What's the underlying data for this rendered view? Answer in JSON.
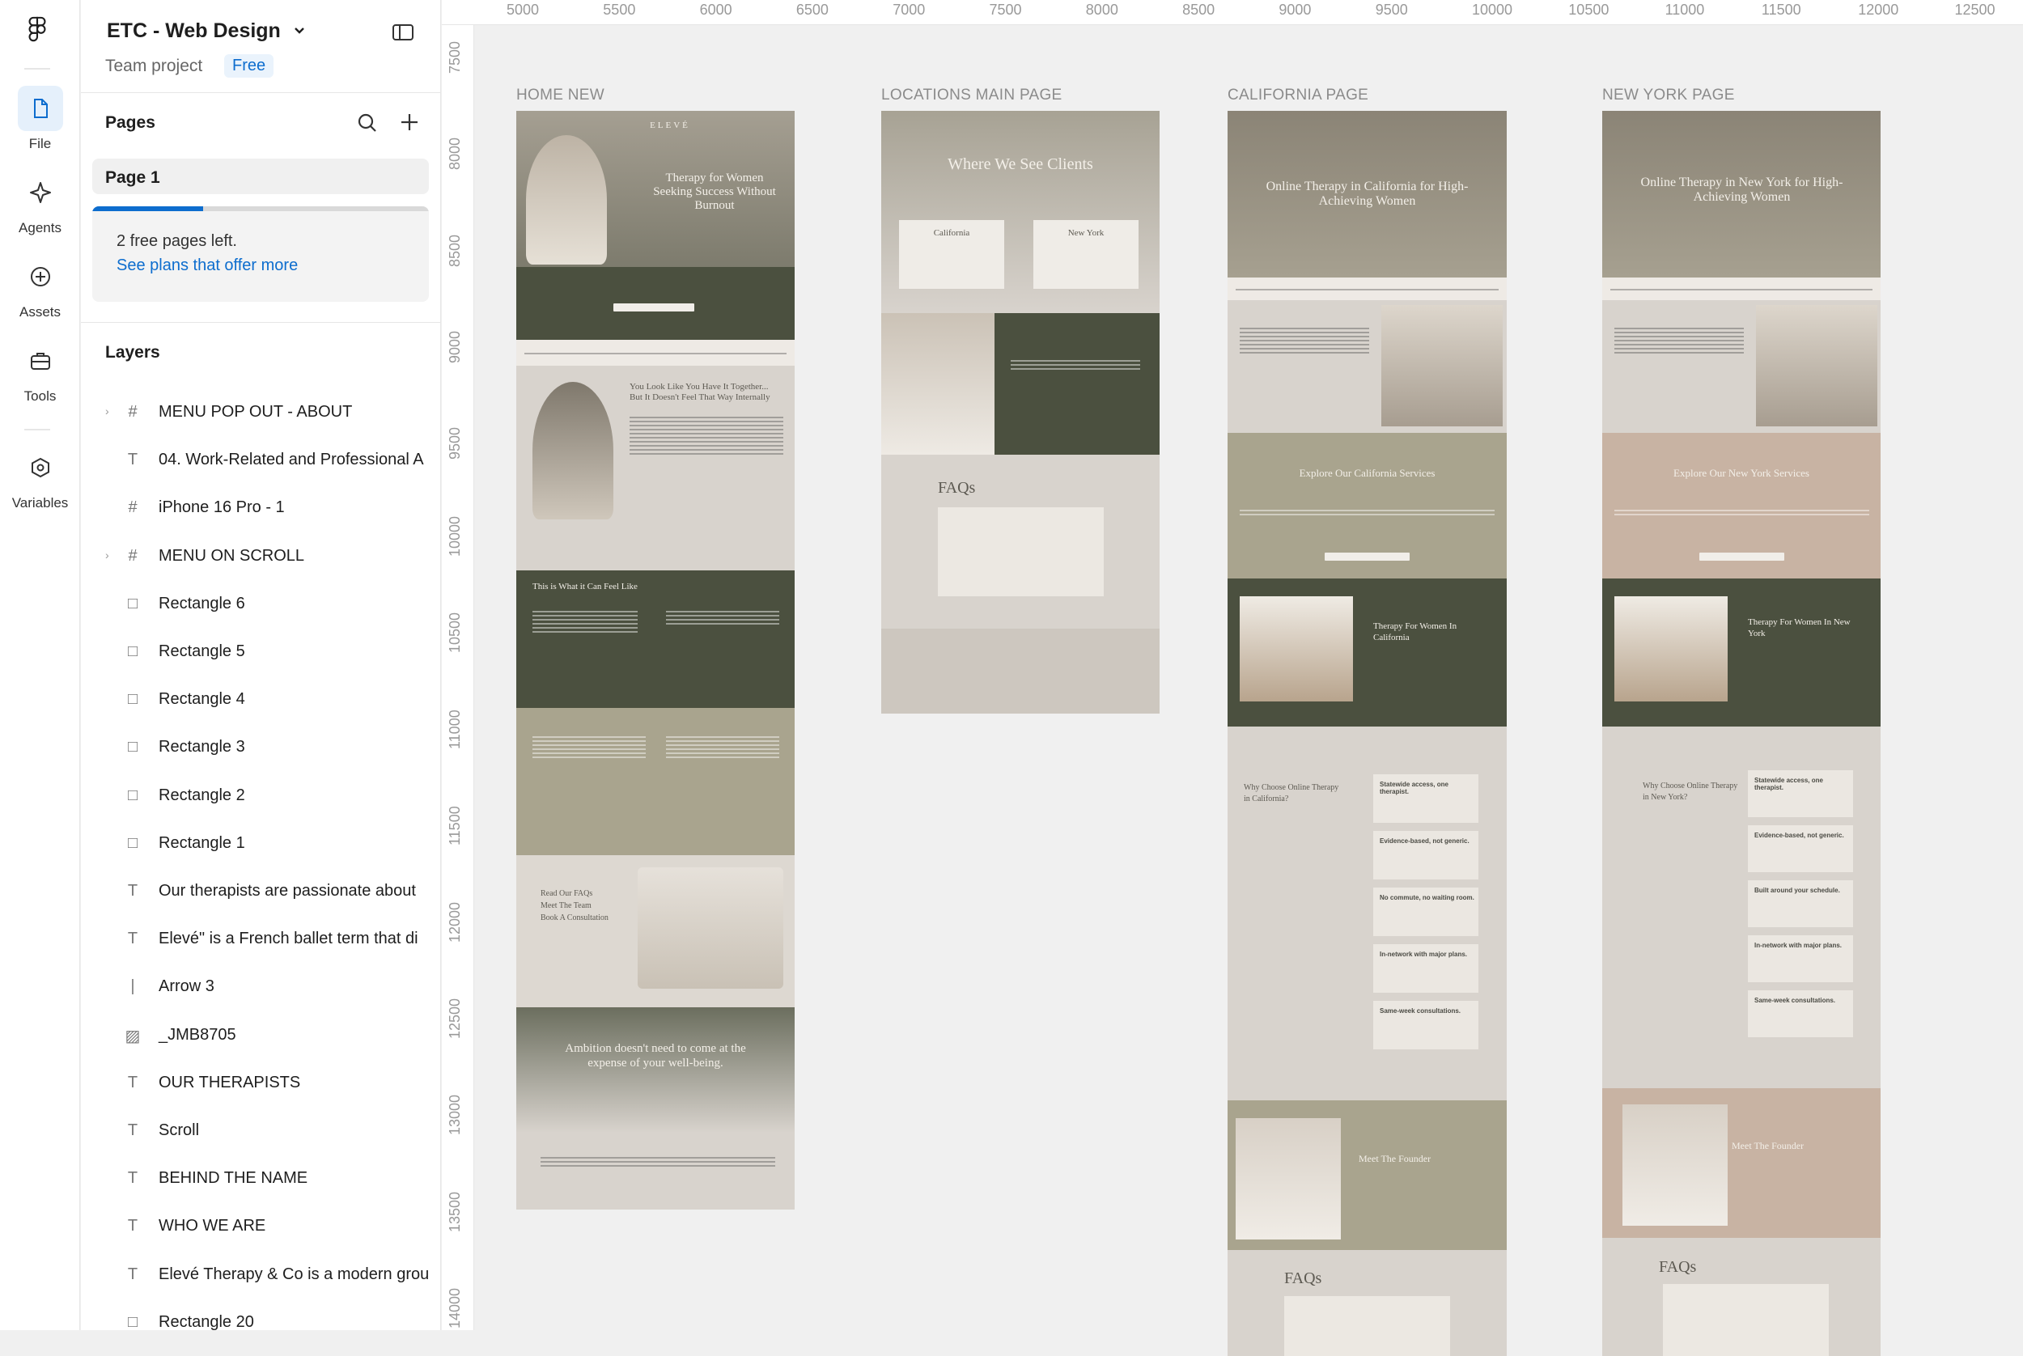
{
  "app": {
    "file_title": "ETC - Web Design",
    "team": "Team project",
    "plan_badge": "Free"
  },
  "rail": {
    "items": [
      {
        "label": "File",
        "icon": "file-icon"
      },
      {
        "label": "Agents",
        "icon": "agents-icon"
      },
      {
        "label": "Assets",
        "icon": "assets-icon"
      },
      {
        "label": "Tools",
        "icon": "tools-icon"
      },
      {
        "label": "Variables",
        "icon": "variables-icon"
      }
    ]
  },
  "pages": {
    "heading": "Pages",
    "items": [
      "Page 1"
    ],
    "free_pages_text": "2 free pages left.",
    "plans_link": "See plans that offer more",
    "usage_fraction": 0.33
  },
  "layers": {
    "heading": "Layers",
    "items": [
      {
        "label": "MENU POP OUT - ABOUT",
        "type": "frame",
        "expandable": true
      },
      {
        "label": "04. Work-Related and Professional A",
        "type": "text",
        "expandable": false
      },
      {
        "label": "iPhone 16 Pro - 1",
        "type": "frame",
        "expandable": false
      },
      {
        "label": "MENU ON SCROLL",
        "type": "frame",
        "expandable": true
      },
      {
        "label": "Rectangle 6",
        "type": "rect",
        "expandable": false
      },
      {
        "label": "Rectangle 5",
        "type": "rect",
        "expandable": false
      },
      {
        "label": "Rectangle 4",
        "type": "rect",
        "expandable": false
      },
      {
        "label": "Rectangle 3",
        "type": "rect",
        "expandable": false
      },
      {
        "label": "Rectangle 2",
        "type": "rect",
        "expandable": false
      },
      {
        "label": "Rectangle 1",
        "type": "rect",
        "expandable": false
      },
      {
        "label": "Our therapists are passionate about",
        "type": "text",
        "expandable": false
      },
      {
        "label": "Elevé\" is a French ballet term that di",
        "type": "text",
        "expandable": false
      },
      {
        "label": "Arrow 3",
        "type": "line",
        "expandable": false
      },
      {
        "label": "_JMB8705",
        "type": "image",
        "expandable": false
      },
      {
        "label": "OUR THERAPISTS",
        "type": "text",
        "expandable": false
      },
      {
        "label": "Scroll",
        "type": "text",
        "expandable": false
      },
      {
        "label": "BEHIND THE NAME",
        "type": "text",
        "expandable": false
      },
      {
        "label": "WHO WE ARE",
        "type": "text",
        "expandable": false
      },
      {
        "label": "Elevé Therapy & Co is a modern grou",
        "type": "text",
        "expandable": false
      },
      {
        "label": "Rectangle 20",
        "type": "rect",
        "expandable": false
      }
    ]
  },
  "ruler": {
    "x_ticks": [
      "5000",
      "5500",
      "6000",
      "6500",
      "7000",
      "7500",
      "8000",
      "8500",
      "9000",
      "9500",
      "10000",
      "10500",
      "11000",
      "11500",
      "12000",
      "12500"
    ],
    "y_ticks": [
      "7500",
      "8000",
      "8500",
      "9000",
      "9500",
      "10000",
      "10500",
      "11000",
      "11500",
      "12000",
      "12500",
      "13000",
      "13500",
      "14000"
    ]
  },
  "frames": [
    {
      "label": "HOME NEW",
      "hero_title": "Therapy for Women Seeking Success Without Burnout",
      "section_title": "You Look Like You Have It Together... But It Doesn't Feel That Way Internally",
      "feel_title": "This is What it Can Feel Like",
      "quote": "Ambition doesn't need to come at the expense of your well-being.",
      "next_steps": [
        "Read Our FAQs",
        "Meet The Team",
        "Book A Consultation"
      ]
    },
    {
      "label": "LOCATIONS MAIN PAGE",
      "hero_title": "Where We See Clients",
      "card_a": "California",
      "card_b": "New York",
      "faq_title": "FAQs"
    },
    {
      "label": "CALIFORNIA PAGE",
      "hero_title": "Online Therapy in California for High-Achieving Women",
      "services_title": "Explore Our California Services",
      "women_title": "Therapy For Women In California",
      "why_title": "Why Choose Online Therapy in California?",
      "founder_title": "Meet The Founder",
      "faq_title": "FAQs",
      "benefits": [
        "Statewide access, one therapist.",
        "Evidence-based, not generic.",
        "No commute, no waiting room.",
        "In-network with major plans.",
        "Same-week consultations."
      ]
    },
    {
      "label": "NEW YORK PAGE",
      "hero_title": "Online Therapy in New York for High-Achieving Women",
      "services_title": "Explore Our New York Services",
      "women_title": "Therapy For Women In New York",
      "why_title": "Why Choose Online Therapy in New York?",
      "founder_title": "Meet The Founder",
      "faq_title": "FAQs",
      "benefits": [
        "Statewide access, one therapist.",
        "Evidence-based, not generic.",
        "Built around your schedule.",
        "In-network with major plans.",
        "Same-week consultations."
      ]
    }
  ],
  "colors": {
    "accent": "#0d6dce",
    "olive_dark": "#4b503f",
    "sage": "#a9a48e",
    "blush": "#c8b3a3",
    "stone": "#d8d3cd"
  }
}
